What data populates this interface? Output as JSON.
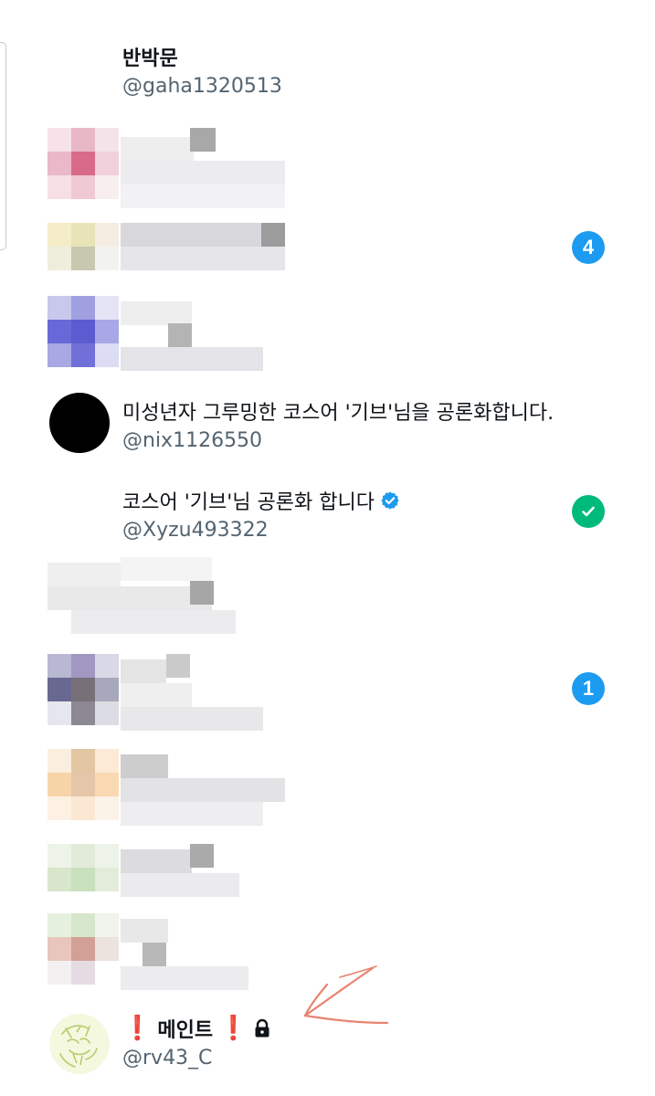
{
  "accounts": [
    {
      "name": "반박문",
      "handle": "@gaha1320513"
    },
    {
      "name": "미성년자 그루밍한 코스어 '기브'님을 공론화합니다.",
      "handle": "@nix1126550"
    },
    {
      "name": "코스어 '기브'님 공론화 합니다",
      "handle": "@Xyzu493322"
    },
    {
      "name": "메인트",
      "name_prefix": "❗",
      "name_suffix": "❗",
      "handle": "@rv43_C"
    }
  ],
  "badges": {
    "row_2_count": "4",
    "row_7_count": "1"
  },
  "colors": {
    "badge_blue": "#1d9bf0",
    "badge_green": "#00ba7c",
    "annotation_arrow": "#e8846f"
  },
  "icons": [
    "verified-icon",
    "check-icon",
    "lock-icon",
    "arrow-annotation"
  ]
}
